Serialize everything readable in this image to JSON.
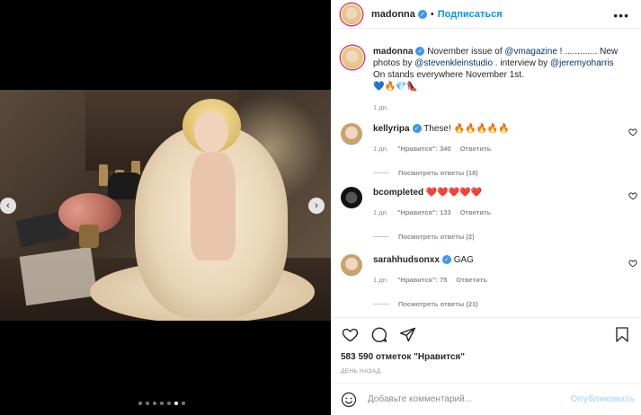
{
  "post": {
    "username": "madonna",
    "follow_label": "Подписаться",
    "more_label": "•••",
    "separator": "•"
  },
  "caption": {
    "username": "madonna",
    "text_1": "November issue of ",
    "mention_1": "@vmagazine",
    "text_2": " ! ............. New photos by ",
    "mention_2": "@stevenkleinstudio",
    "text_3": " . interview by ",
    "mention_3": "@jeremyoharris",
    "line_2": "On stands everywhere November 1st.",
    "emojis": "💙🔥💎👠",
    "time": "1 дн."
  },
  "comments": [
    {
      "username": "kellyripa",
      "text": "These! 🔥🔥🔥🔥🔥",
      "time": "1 дн.",
      "likes": "\"Нравится\": 340",
      "reply": "Ответить",
      "view_replies": "Посмотреть ответы (18)"
    },
    {
      "username": "bcompleted",
      "text": "❤️❤️❤️❤️❤️",
      "time": "1 дн.",
      "likes": "\"Нравится\": 133",
      "reply": "Ответить",
      "view_replies": "Посмотреть ответы (2)"
    },
    {
      "username": "sarahhudsonxx",
      "text": "GAG",
      "time": "1 дн.",
      "likes": "\"Нравится\": 75",
      "reply": "Ответить",
      "view_replies": "Посмотреть ответы (21)"
    }
  ],
  "actions": {
    "likes": "583 590 отметок \"Нравится\"",
    "date": "ДЕНЬ НАЗАД"
  },
  "comment_box": {
    "placeholder": "Добавьте комментарий...",
    "post_label": "Опубликовать"
  },
  "carousel": {
    "prev": "‹",
    "next": "›",
    "dot_count": 7,
    "active_index": 5
  },
  "colors": {
    "accent": "#0095f6",
    "verified": "#3897f0",
    "muted": "#8e8e8e"
  },
  "icons": [
    "heart-icon",
    "comment-icon",
    "share-icon",
    "bookmark-icon",
    "emoji-icon",
    "verified-icon",
    "more-icon"
  ]
}
